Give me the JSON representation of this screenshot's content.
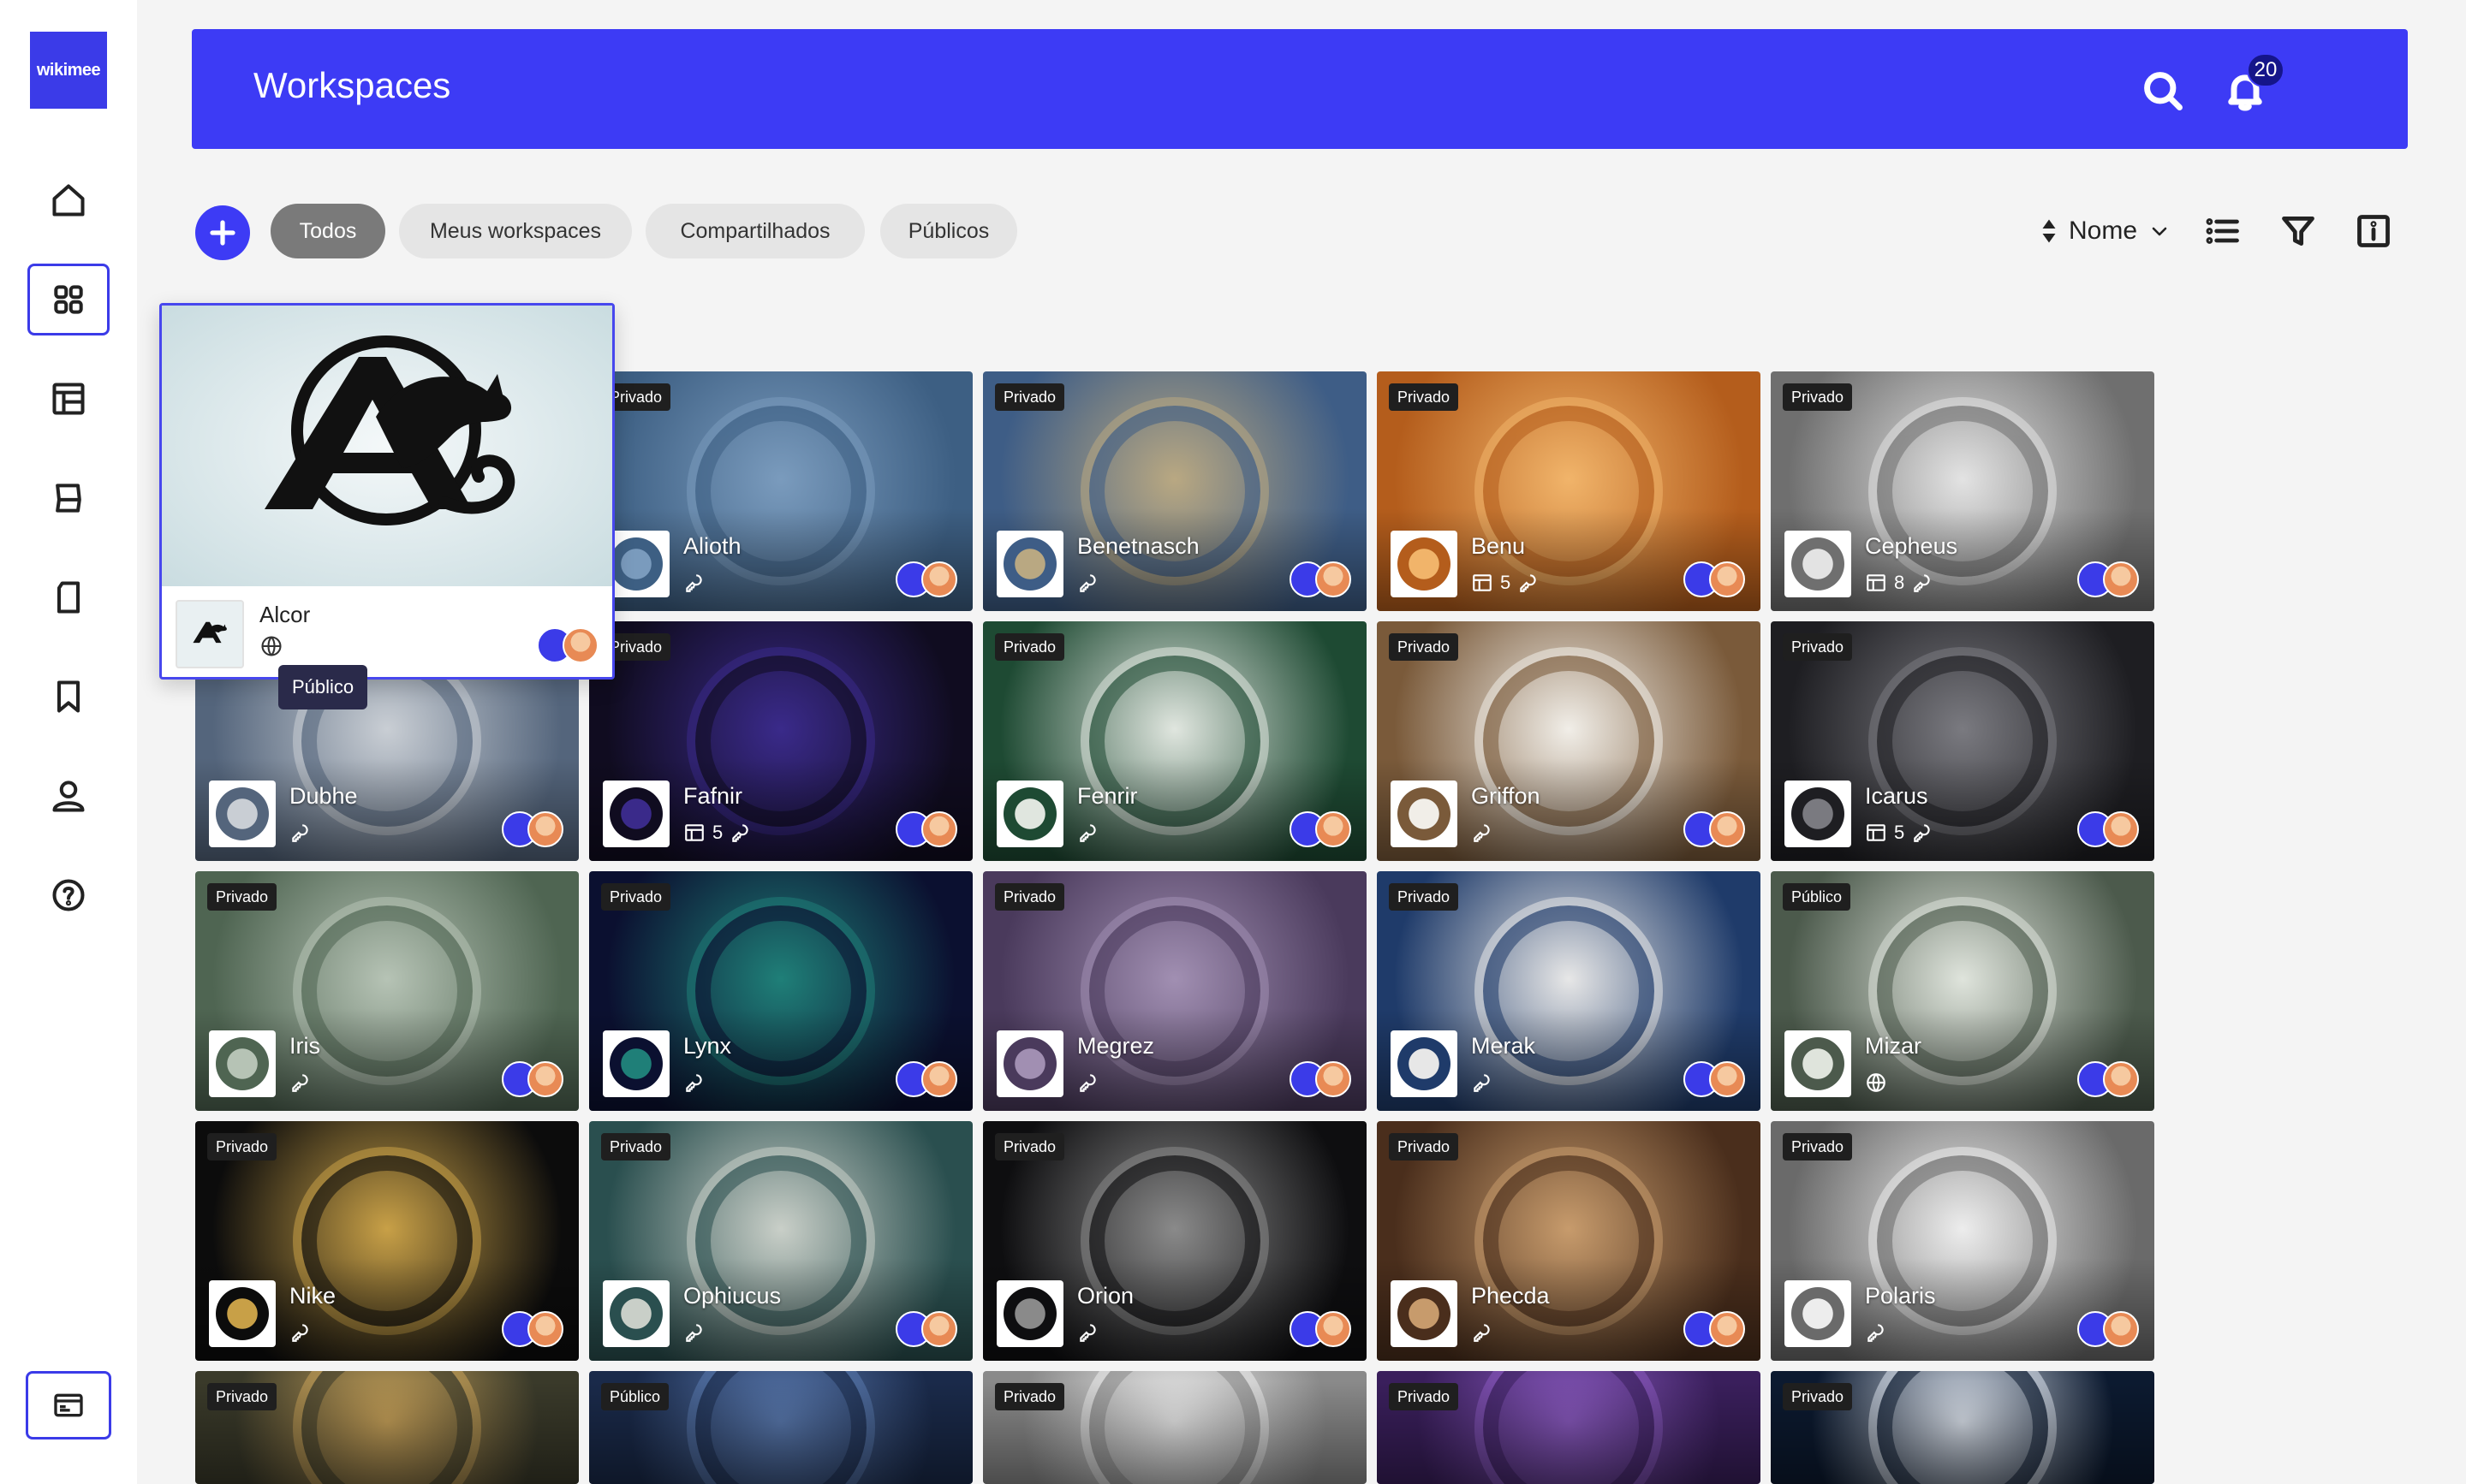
{
  "app": {
    "logo_text": "wikimee"
  },
  "header": {
    "title": "Workspaces",
    "notification_count": "20"
  },
  "filters": {
    "chips": [
      {
        "label": "Todos",
        "active": true
      },
      {
        "label": "Meus workspaces",
        "active": false
      },
      {
        "label": "Compartilhados",
        "active": false
      },
      {
        "label": "Públicos",
        "active": false
      }
    ],
    "sort_label": "Nome"
  },
  "hover_card": {
    "name": "Alcor",
    "tooltip": "Público",
    "visibility_icon": "globe-icon"
  },
  "cards": [
    {
      "name": "Alioth",
      "tag": "Privado",
      "count": "",
      "meta_icon": "key-icon",
      "colors": [
        "#3d5f83",
        "#7a9bbd"
      ]
    },
    {
      "name": "Benetnasch",
      "tag": "Privado",
      "count": "",
      "meta_icon": "key-icon",
      "colors": [
        "#3e5d86",
        "#b9a882"
      ]
    },
    {
      "name": "Benu",
      "tag": "Privado",
      "count": "5",
      "meta_icon": "key-icon",
      "colors": [
        "#b45d1c",
        "#f1b46a"
      ]
    },
    {
      "name": "Cepheus",
      "tag": "Privado",
      "count": "8",
      "meta_icon": "key-icon",
      "colors": [
        "#6f6f6f",
        "#e3e3e3"
      ]
    },
    {
      "name": "Dubhe",
      "tag": "",
      "count": "",
      "meta_icon": "key-icon",
      "colors": [
        "#54657c",
        "#c9ced4"
      ]
    },
    {
      "name": "Fafnir",
      "tag": "Privado",
      "count": "5",
      "meta_icon": "key-icon",
      "colors": [
        "#100c20",
        "#3a2a8a"
      ]
    },
    {
      "name": "Fenrir",
      "tag": "Privado",
      "count": "",
      "meta_icon": "key-icon",
      "colors": [
        "#1e4a33",
        "#e0e6df"
      ]
    },
    {
      "name": "Griffon",
      "tag": "Privado",
      "count": "",
      "meta_icon": "key-icon",
      "colors": [
        "#7a5a3a",
        "#f1eee8"
      ]
    },
    {
      "name": "Icarus",
      "tag": "Privado",
      "count": "5",
      "meta_icon": "key-icon",
      "colors": [
        "#1e1e22",
        "#7a7a80"
      ]
    },
    {
      "name": "Iris",
      "tag": "Privado",
      "count": "",
      "meta_icon": "key-icon",
      "colors": [
        "#4f6552",
        "#b6c3b5"
      ]
    },
    {
      "name": "Lynx",
      "tag": "Privado",
      "count": "",
      "meta_icon": "key-icon",
      "colors": [
        "#0b1030",
        "#1f7f78"
      ]
    },
    {
      "name": "Megrez",
      "tag": "Privado",
      "count": "",
      "meta_icon": "key-icon",
      "colors": [
        "#4a3a5c",
        "#a18fb2"
      ]
    },
    {
      "name": "Merak",
      "tag": "Privado",
      "count": "",
      "meta_icon": "key-icon",
      "colors": [
        "#1f3b6a",
        "#e7e7e7"
      ]
    },
    {
      "name": "Mizar",
      "tag": "Público",
      "count": "",
      "meta_icon": "globe-icon",
      "colors": [
        "#4c5a4c",
        "#dfe4dc"
      ]
    },
    {
      "name": "Nike",
      "tag": "Privado",
      "count": "",
      "meta_icon": "key-icon",
      "colors": [
        "#0c0c0c",
        "#c8a047"
      ]
    },
    {
      "name": "Ophiucus",
      "tag": "Privado",
      "count": "",
      "meta_icon": "key-icon",
      "colors": [
        "#2a4f4f",
        "#c9cfc8"
      ]
    },
    {
      "name": "Orion",
      "tag": "Privado",
      "count": "",
      "meta_icon": "key-icon",
      "colors": [
        "#0e0e10",
        "#8a8a8a"
      ]
    },
    {
      "name": "Phecda",
      "tag": "Privado",
      "count": "",
      "meta_icon": "key-icon",
      "colors": [
        "#4a2e1c",
        "#c79b6c"
      ]
    },
    {
      "name": "Polaris",
      "tag": "Privado",
      "count": "",
      "meta_icon": "key-icon",
      "colors": [
        "#6a6a6a",
        "#ededed"
      ]
    },
    {
      "name": "",
      "tag": "Privado",
      "count": "",
      "meta_icon": "",
      "colors": [
        "#3a3a2a",
        "#c9a35a"
      ]
    },
    {
      "name": "",
      "tag": "Público",
      "count": "",
      "meta_icon": "",
      "colors": [
        "#1a2a4a",
        "#5a7ab0"
      ]
    },
    {
      "name": "",
      "tag": "Privado",
      "count": "",
      "meta_icon": "",
      "colors": [
        "#8a8a8a",
        "#ededed"
      ]
    },
    {
      "name": "",
      "tag": "Privado",
      "count": "",
      "meta_icon": "",
      "colors": [
        "#3a1f5c",
        "#8a5ac0"
      ]
    },
    {
      "name": "",
      "tag": "Privado",
      "count": "",
      "meta_icon": "",
      "colors": [
        "#0c1a30",
        "#dfe6f0"
      ]
    }
  ]
}
